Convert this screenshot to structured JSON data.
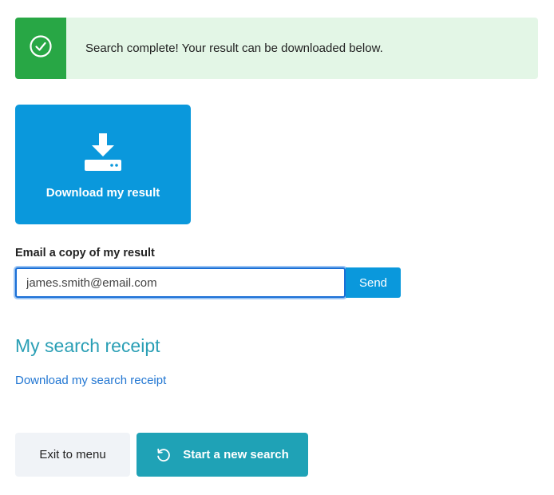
{
  "banner": {
    "message": "Search complete! Your result can be downloaded below.",
    "icon": "check-circle-icon",
    "color": "#28a745"
  },
  "download_tile": {
    "label": "Download my result",
    "icon": "download-icon",
    "color": "#0a98dc"
  },
  "email": {
    "label": "Email a copy of my result",
    "value": "james.smith@email.com",
    "send_label": "Send"
  },
  "receipt": {
    "heading": "My search receipt",
    "link_label": "Download my search receipt"
  },
  "actions": {
    "exit_label": "Exit to menu",
    "new_search_label": "Start a new search",
    "new_search_icon": "refresh-icon"
  }
}
